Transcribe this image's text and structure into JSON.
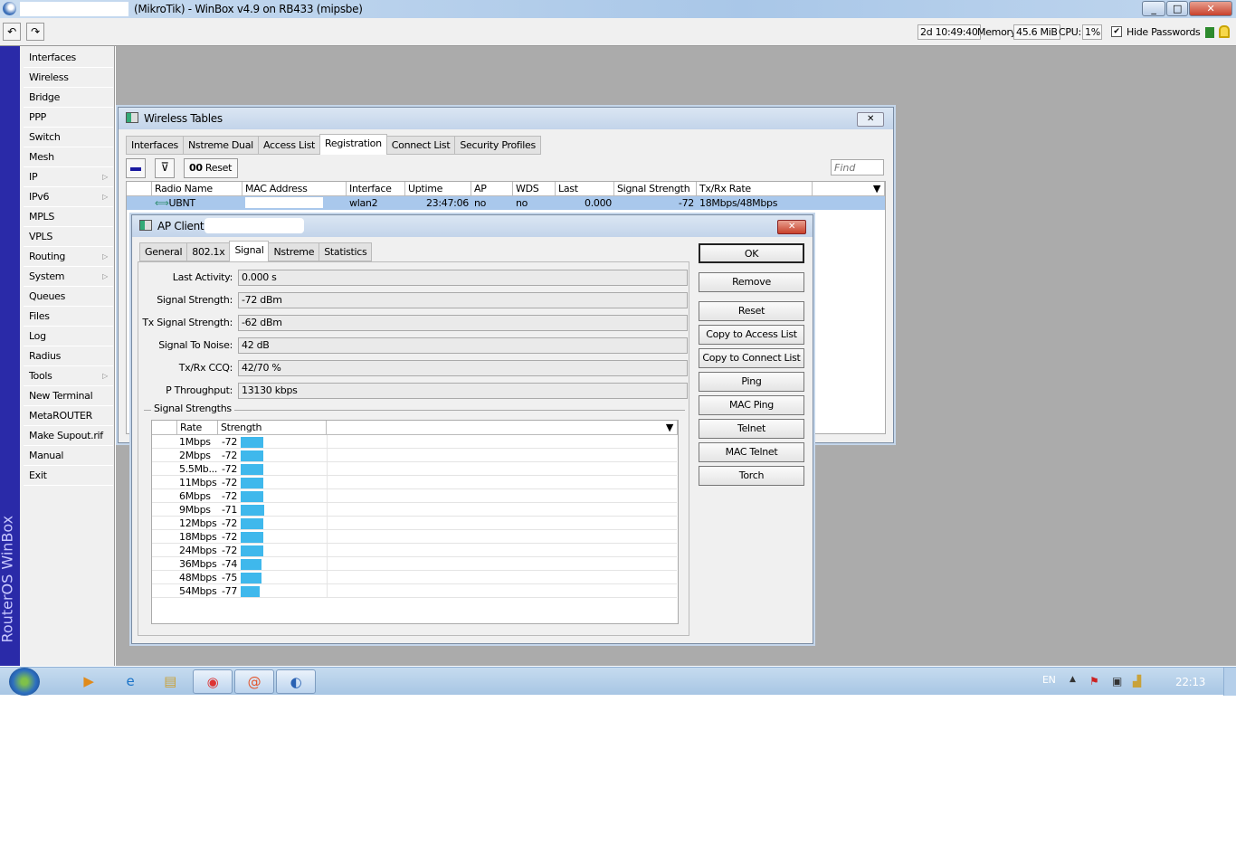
{
  "window": {
    "title": "(MikroTik) - WinBox v4.9 on RB433 (mipsbe)",
    "minimize": "_",
    "maximize": "□",
    "close": "✕"
  },
  "toolbar": {
    "undo": "↶",
    "redo": "↷",
    "uptime": "2d 10:49:40",
    "memory_label": "Memory:",
    "memory": "45.6 MiB",
    "cpu_label": "CPU:",
    "cpu": "1%",
    "hide_passwords": "Hide Passwords",
    "hide_passwords_checked": true
  },
  "sidebar": {
    "brand": "RouterOS WinBox",
    "items": [
      {
        "label": "Interfaces"
      },
      {
        "label": "Wireless"
      },
      {
        "label": "Bridge"
      },
      {
        "label": "PPP"
      },
      {
        "label": "Switch"
      },
      {
        "label": "Mesh"
      },
      {
        "label": "IP",
        "sub": true
      },
      {
        "label": "IPv6",
        "sub": true
      },
      {
        "label": "MPLS"
      },
      {
        "label": "VPLS"
      },
      {
        "label": "Routing",
        "sub": true
      },
      {
        "label": "System",
        "sub": true
      },
      {
        "label": "Queues"
      },
      {
        "label": "Files"
      },
      {
        "label": "Log"
      },
      {
        "label": "Radius"
      },
      {
        "label": "Tools",
        "sub": true
      },
      {
        "label": "New Terminal"
      },
      {
        "label": "MetaROUTER"
      },
      {
        "label": "Make Supout.rif"
      },
      {
        "label": "Manual"
      },
      {
        "label": "Exit"
      }
    ]
  },
  "wireless_tables": {
    "title": "Wireless Tables",
    "close": "✕",
    "tabs": [
      "Interfaces",
      "Nstreme Dual",
      "Access List",
      "Registration",
      "Connect List",
      "Security Profiles"
    ],
    "active_tab": 3,
    "reset_label": "Reset",
    "reset_prefix": "00",
    "find_placeholder": "Find",
    "columns": [
      "Radio Name",
      "MAC Address",
      "Interface",
      "Uptime",
      "AP",
      "WDS",
      "Last Activit...",
      "Signal Strength (...",
      "Tx/Rx Rate"
    ],
    "rows": [
      {
        "radio_name": "UBNT",
        "mac": "",
        "interface": "wlan2",
        "uptime": "23:47:06",
        "ap": "no",
        "wds": "no",
        "last_activity": "0.000",
        "signal": "-72",
        "rate": "18Mbps/48Mbps"
      }
    ]
  },
  "ap_client": {
    "title": "AP Client",
    "close": "✕",
    "tabs": [
      "General",
      "802.1x",
      "Signal",
      "Nstreme",
      "Statistics"
    ],
    "active_tab": 2,
    "fields": [
      {
        "label": "Last Activity:",
        "value": "0.000 s"
      },
      {
        "label": "Signal Strength:",
        "value": "-72 dBm"
      },
      {
        "label": "Tx Signal Strength:",
        "value": "-62 dBm"
      },
      {
        "label": "Signal To Noise:",
        "value": "42 dB"
      },
      {
        "label": "Tx/Rx CCQ:",
        "value": "42/70 %"
      },
      {
        "label": "P Throughput:",
        "value": "13130 kbps"
      }
    ],
    "section": "Signal Strengths",
    "strength_columns": [
      "Rate",
      "Strength"
    ],
    "strengths": [
      {
        "rate": "1Mbps",
        "value": -72
      },
      {
        "rate": "2Mbps",
        "value": -72
      },
      {
        "rate": "5.5Mb...",
        "value": -72
      },
      {
        "rate": "11Mbps",
        "value": -72
      },
      {
        "rate": "6Mbps",
        "value": -72
      },
      {
        "rate": "9Mbps",
        "value": -71
      },
      {
        "rate": "12Mbps",
        "value": -72
      },
      {
        "rate": "18Mbps",
        "value": -72
      },
      {
        "rate": "24Mbps",
        "value": -72
      },
      {
        "rate": "36Mbps",
        "value": -74
      },
      {
        "rate": "48Mbps",
        "value": -75
      },
      {
        "rate": "54Mbps",
        "value": -77
      }
    ],
    "bar_color": "#3fb8ec",
    "buttons": [
      "OK",
      "Remove",
      "Reset",
      "Copy to Access List",
      "Copy to Connect List",
      "Ping",
      "MAC Ping",
      "Telnet",
      "MAC Telnet",
      "Torch"
    ]
  },
  "taskbar": {
    "lang": "EN",
    "clock": "22:13"
  }
}
